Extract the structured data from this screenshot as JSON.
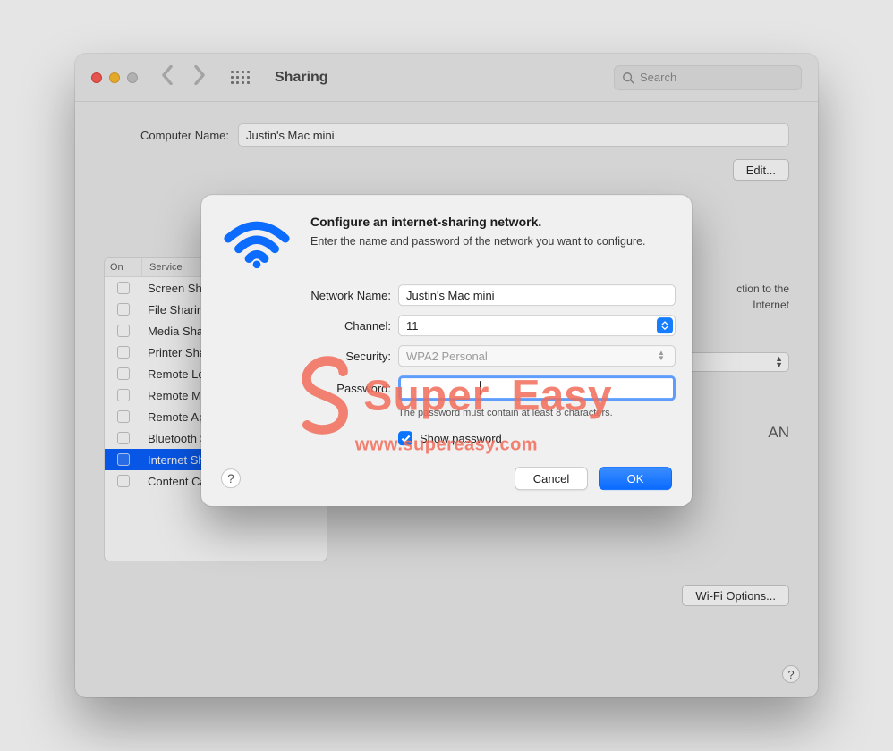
{
  "window": {
    "title": "Sharing",
    "search_placeholder": "Search"
  },
  "main": {
    "computer_name_label": "Computer Name:",
    "computer_name_value": "Justin's Mac mini",
    "edit_label": "Edit...",
    "table_header_on": "On",
    "table_header_service": "Service",
    "services": [
      "Screen Sharing",
      "File Sharing",
      "Media Sharing",
      "Printer Sharing",
      "Remote Login",
      "Remote Management",
      "Remote Apple Events",
      "Bluetooth Sharing",
      "Internet Sharing",
      "Content Caching"
    ],
    "selected_service_index": 8,
    "right_info_line1": "ction to the",
    "right_info_line2": "Internet",
    "lan_label": "AN",
    "wifi_options_label": "Wi-Fi Options..."
  },
  "modal": {
    "title": "Configure an internet-sharing network.",
    "subtitle": "Enter the name and password of the network you want to configure.",
    "network_name_label": "Network Name:",
    "network_name_value": "Justin's Mac mini",
    "channel_label": "Channel:",
    "channel_value": "11",
    "security_label": "Security:",
    "security_value": "WPA2 Personal",
    "password_label": "Password:",
    "password_value": "",
    "password_hint": "The password must contain at least 8 characters.",
    "show_password_label": "Show password",
    "show_password_checked": true,
    "cancel_label": "Cancel",
    "ok_label": "OK"
  },
  "watermark": {
    "brand_super": "Super",
    "brand_easy": "Easy",
    "url": "www.supereasy.com"
  },
  "colors": {
    "accent": "#0a74ff",
    "watermark": "#f26d5b"
  }
}
